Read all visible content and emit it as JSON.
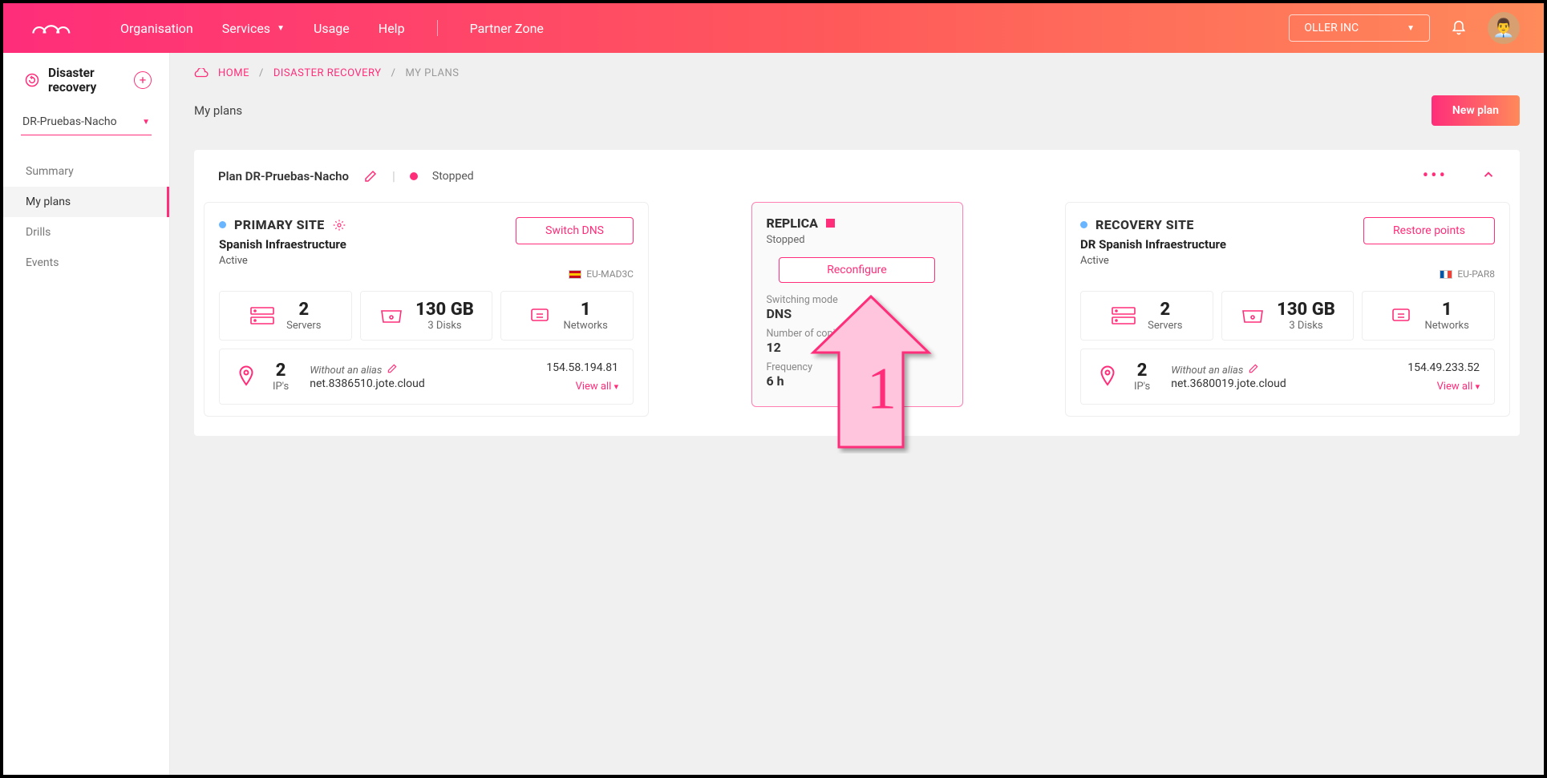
{
  "top": {
    "nav": [
      "Organisation",
      "Services",
      "Usage",
      "Help",
      "Partner Zone"
    ],
    "org": "OLLER INC"
  },
  "sidebar": {
    "title": "Disaster recovery",
    "select": "DR-Pruebas-Nacho",
    "items": [
      "Summary",
      "My plans",
      "Drills",
      "Events"
    ],
    "active": 1
  },
  "breadcrumb": {
    "home": "HOME",
    "sec": "DISASTER RECOVERY",
    "cur": "MY PLANS"
  },
  "page": {
    "title": "My plans",
    "new_btn": "New plan"
  },
  "plan": {
    "name": "Plan DR-Pruebas-Nacho",
    "status": "Stopped"
  },
  "primary": {
    "heading": "PRIMARY SITE",
    "subtitle": "Spanish Infraestructure",
    "active": "Active",
    "btn": "Switch DNS",
    "region": "EU-MAD3C",
    "servers": {
      "v": "2",
      "l": "Servers"
    },
    "disks": {
      "v": "130 GB",
      "l": "3 Disks"
    },
    "nets": {
      "v": "1",
      "l": "Networks"
    },
    "ips": {
      "v": "2",
      "l": "IP's"
    },
    "alias": "Without an alias",
    "net": "net.8386510.jote.cloud",
    "ip": "154.58.194.81",
    "viewall": "View all"
  },
  "replica": {
    "heading": "REPLICA",
    "status": "Stopped",
    "btn": "Reconfigure",
    "mode_l": "Switching mode",
    "mode_v": "DNS",
    "copies_l": "Number of copies",
    "copies_v": "12",
    "freq_l": "Frequency",
    "freq_v": "6 h"
  },
  "recovery": {
    "heading": "RECOVERY SITE",
    "subtitle": "DR Spanish Infraestructure",
    "active": "Active",
    "btn": "Restore points",
    "region": "EU-PAR8",
    "servers": {
      "v": "2",
      "l": "Servers"
    },
    "disks": {
      "v": "130 GB",
      "l": "3 Disks"
    },
    "nets": {
      "v": "1",
      "l": "Networks"
    },
    "ips": {
      "v": "2",
      "l": "IP's"
    },
    "alias": "Without an alias",
    "net": "net.3680019.jote.cloud",
    "ip": "154.49.233.52",
    "viewall": "View all"
  },
  "annotation": {
    "num": "1"
  }
}
